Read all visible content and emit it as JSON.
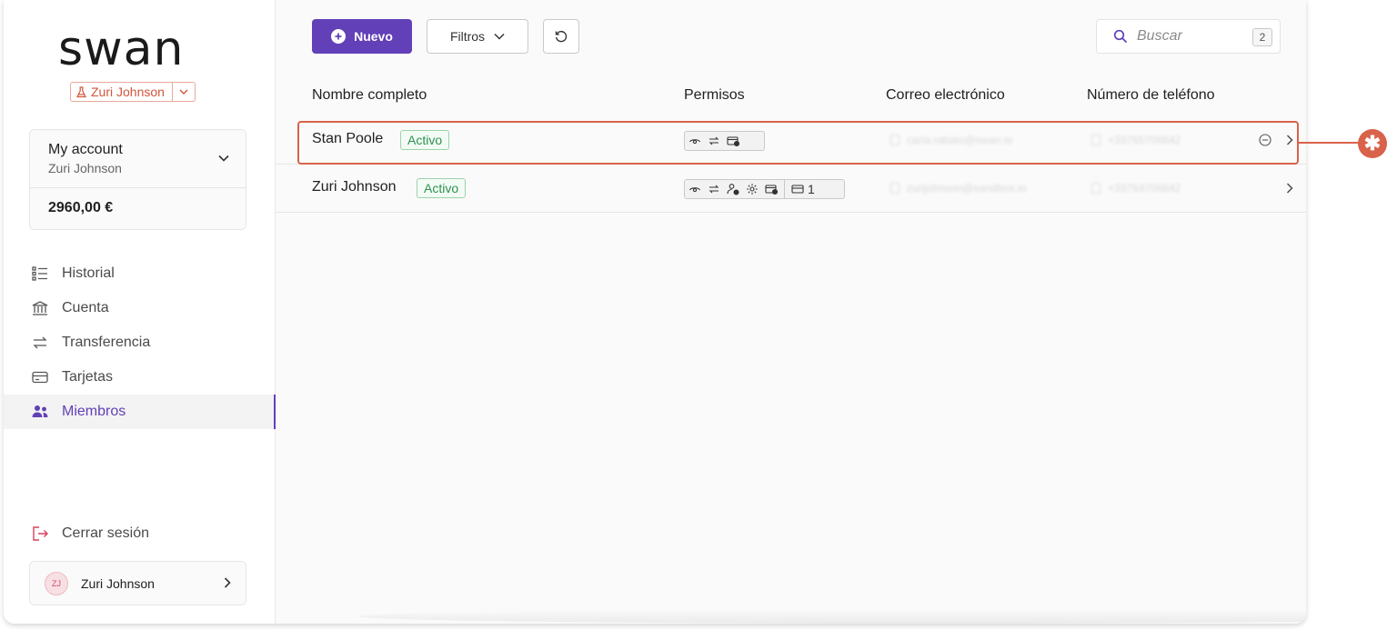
{
  "brand": {
    "logo_text": "swan",
    "accent": "#6240b8",
    "highlight": "#d9624a"
  },
  "project": {
    "name": "Zuri Johnson",
    "icon": "flask-icon"
  },
  "account": {
    "title": "My account",
    "owner": "Zuri Johnson",
    "balance": "2960,00 €"
  },
  "nav": [
    {
      "label": "Historial",
      "icon": "list-icon",
      "active": false
    },
    {
      "label": "Cuenta",
      "icon": "bank-icon",
      "active": false
    },
    {
      "label": "Transferencia",
      "icon": "transfer-icon",
      "active": false
    },
    {
      "label": "Tarjetas",
      "icon": "card-icon",
      "active": false
    },
    {
      "label": "Miembros",
      "icon": "people-icon",
      "active": true
    }
  ],
  "logout_label": "Cerrar sesión",
  "user": {
    "initials": "ZJ",
    "name": "Zuri Johnson"
  },
  "toolbar": {
    "new_label": "Nuevo",
    "filters_label": "Filtros",
    "search_placeholder": "Buscar",
    "search_count": "2"
  },
  "table": {
    "columns": [
      "Nombre completo",
      "Permisos",
      "Correo electrónico",
      "Número de teléfono"
    ],
    "rows": [
      {
        "name": "Stan Poole",
        "status": "Activo",
        "permissions": [
          "view-icon",
          "transfer-icon",
          "card-add-icon"
        ],
        "email": "carla.rabato@swan.io",
        "phone": "+33765706642"
      },
      {
        "name": "Zuri Johnson",
        "status": "Activo",
        "permissions": [
          "view-icon",
          "transfer-icon",
          "user-add-icon",
          "settings-icon",
          "card-add-icon"
        ],
        "cards_count": "1",
        "email": "zurijohnson@sandbox.io",
        "phone": "+33764706642"
      }
    ]
  },
  "annotation": {
    "marker": "✱"
  }
}
